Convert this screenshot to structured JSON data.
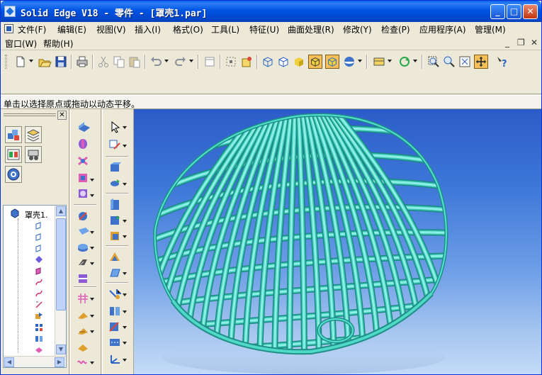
{
  "window": {
    "title": "Solid Edge V18 - 零件 - [罩壳1.par]",
    "controls": {
      "minimize": "_",
      "maximize": "□",
      "close": "✕"
    }
  },
  "menu": {
    "row1": [
      "文件(F)",
      "编辑(E)",
      "视图(V)",
      "插入(I)",
      "格式(O)",
      "工具(L)",
      "特征(U)",
      "曲面处理(R)",
      "修改(Y)",
      "检查(P)",
      "应用程序(A)",
      "管理(M)"
    ],
    "row2": [
      "窗口(W)",
      "帮助(H)"
    ],
    "mdi": {
      "minimize": "_",
      "restore": "❐",
      "close": "✕"
    }
  },
  "prompt": {
    "text": "单击以选择原点或拖动以动态平移。"
  },
  "tree": {
    "root_label": "罩壳1."
  },
  "panel": {
    "close": "✕"
  },
  "colors": {
    "titlebar": "#0054e3",
    "model": "#3cc9b9",
    "viewport_top": "#2c5cc9",
    "viewport_bottom": "#c4dbf7",
    "selected_tool": "#f5c05a"
  },
  "icons": {
    "toolbar1": [
      "new-icon",
      "open-icon",
      "save-icon",
      "print-icon",
      "cut-icon",
      "copy-icon",
      "paste-icon",
      "undo-icon",
      "redo-icon",
      "new-window-icon",
      "select-icon",
      "wireframe-icon",
      "hidden-line-icon",
      "shaded-icon",
      "shaded-edges-icon",
      "shaded-visible-icon",
      "sphere-icon",
      "view-orient-icon",
      "rotate-icon",
      "zoom-area-icon",
      "zoom-icon",
      "fit-icon",
      "pan-icon",
      "help-icon"
    ]
  }
}
